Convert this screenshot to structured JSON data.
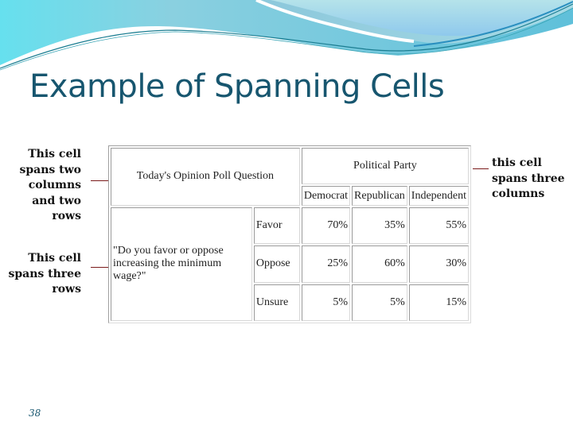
{
  "slide": {
    "title": "Example of Spanning Cells",
    "page_number": "38",
    "theme_colors": {
      "title": "#17566f",
      "wave_light": "#a8dde6",
      "wave_mid": "#6fc6d8",
      "wave_dark": "#1a7e93",
      "connector": "#7a1a1a"
    }
  },
  "annotations": [
    {
      "text": "This cell spans two columns and two rows"
    },
    {
      "text": "This cell spans three rows"
    },
    {
      "text": "this cell spans three columns"
    }
  ],
  "table": {
    "question_header": "Today's Opinion Poll Question",
    "party_header": "Political Party",
    "parties": [
      "Democrat",
      "Republican",
      "Independent"
    ],
    "question": "\"Do you favor or oppose increasing the minimum wage?\"",
    "rows": [
      {
        "label": "Favor",
        "values": [
          "70%",
          "35%",
          "55%"
        ]
      },
      {
        "label": "Oppose",
        "values": [
          "25%",
          "60%",
          "30%"
        ]
      },
      {
        "label": "Unsure",
        "values": [
          "5%",
          "5%",
          "15%"
        ]
      }
    ]
  }
}
